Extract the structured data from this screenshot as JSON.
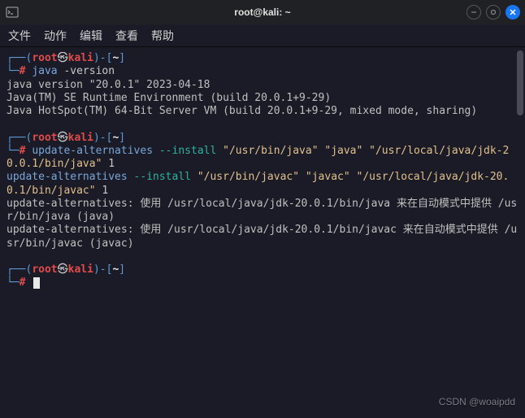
{
  "window": {
    "title": "root@kali: ~"
  },
  "menubar": {
    "items": [
      "文件",
      "动作",
      "编辑",
      "查看",
      "帮助"
    ]
  },
  "prompt": {
    "open_paren": "┌──(",
    "user": "root",
    "at": "㉿",
    "host": "kali",
    "close_user": ")",
    "dash": "-",
    "open_br": "[",
    "cwd": "~",
    "close_br": "]",
    "line2_prefix": "└─",
    "hash": "#"
  },
  "blocks": [
    {
      "cmd": "java -version",
      "cmd_parts": [
        {
          "text": "java ",
          "cls": "c-cmd"
        },
        {
          "text": "-version",
          "cls": "c-white"
        }
      ],
      "output": "java version \"20.0.1\" 2023-04-18\nJava(TM) SE Runtime Environment (build 20.0.1+9-29)\nJava HotSpot(TM) 64-Bit Server VM (build 20.0.1+9-29, mixed mode, sharing)"
    },
    {
      "cmd": "update-alternatives --install \"/usr/bin/java\" \"java\" \"/usr/local/java/jdk-20.0.1/bin/java\" 1",
      "cmd_parts": [
        {
          "text": "update-alternatives ",
          "cls": "c-cmd"
        },
        {
          "text": "--install ",
          "cls": "c-green"
        },
        {
          "text": "\"/usr/bin/java\" \"java\" \"/usr/local/java/jdk-20.0.1/bin/java\"",
          "cls": "c-yellow"
        },
        {
          "text": " 1",
          "cls": "c-white"
        }
      ],
      "output": ""
    },
    {
      "cmd_inline": true,
      "cmd_parts": [
        {
          "text": "update-alternatives ",
          "cls": "c-cmd"
        },
        {
          "text": "--install ",
          "cls": "c-green"
        },
        {
          "text": "\"/usr/bin/javac\" \"javac\" \"/usr/local/java/jdk-20.0.1/bin/javac\"",
          "cls": "c-yellow"
        },
        {
          "text": " 1",
          "cls": "c-white"
        }
      ],
      "output": "update-alternatives: 使用 /usr/local/java/jdk-20.0.1/bin/java 来在自动模式中提供 /usr/bin/java (java)\nupdate-alternatives: 使用 /usr/local/java/jdk-20.0.1/bin/javac 来在自动模式中提供 /usr/bin/javac (javac)"
    }
  ],
  "watermark": "CSDN @woaipdd"
}
